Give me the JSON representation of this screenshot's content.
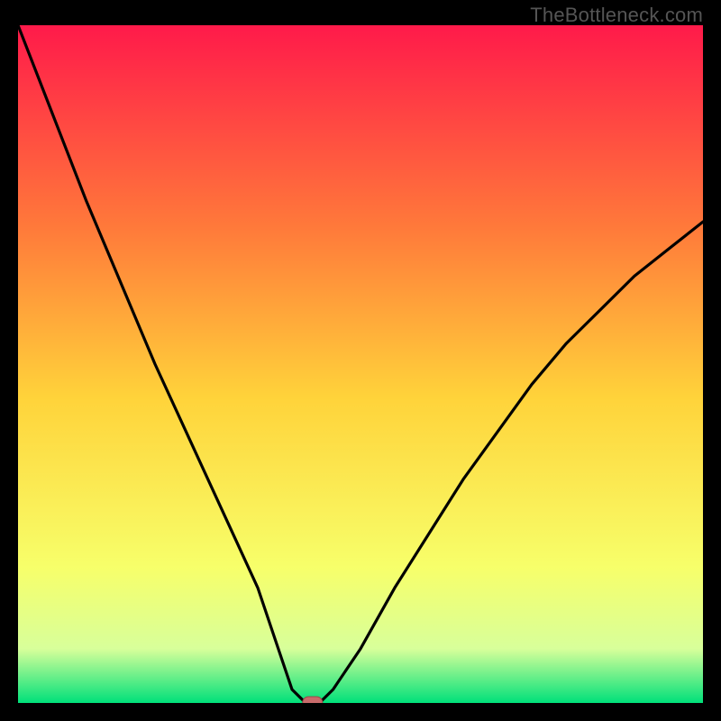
{
  "watermark": "TheBottleneck.com",
  "chart_data": {
    "type": "line",
    "title": "",
    "xlabel": "",
    "ylabel": "",
    "xlim": [
      0,
      100
    ],
    "ylim": [
      0,
      100
    ],
    "x": [
      0,
      5,
      10,
      15,
      20,
      25,
      30,
      35,
      38,
      40,
      42,
      44,
      46,
      50,
      55,
      60,
      65,
      70,
      75,
      80,
      85,
      90,
      95,
      100
    ],
    "values": [
      100,
      87,
      74,
      62,
      50,
      39,
      28,
      17,
      8,
      2,
      0,
      0,
      2,
      8,
      17,
      25,
      33,
      40,
      47,
      53,
      58,
      63,
      67,
      71
    ],
    "minimum_x": 43,
    "marker": {
      "x": 43,
      "y": 0
    },
    "background": "red-yellow-green-vertical-gradient"
  },
  "colors": {
    "gradient_top": "#ff1a4a",
    "gradient_mid_upper": "#ff7a3a",
    "gradient_mid": "#ffd33a",
    "gradient_mid_lower": "#f7ff6a",
    "gradient_low": "#d8ff9a",
    "gradient_bottom": "#00e07a",
    "curve": "#000000",
    "marker_fill": "#c86a6a",
    "marker_stroke": "#9a4a4a",
    "frame": "#000000"
  }
}
